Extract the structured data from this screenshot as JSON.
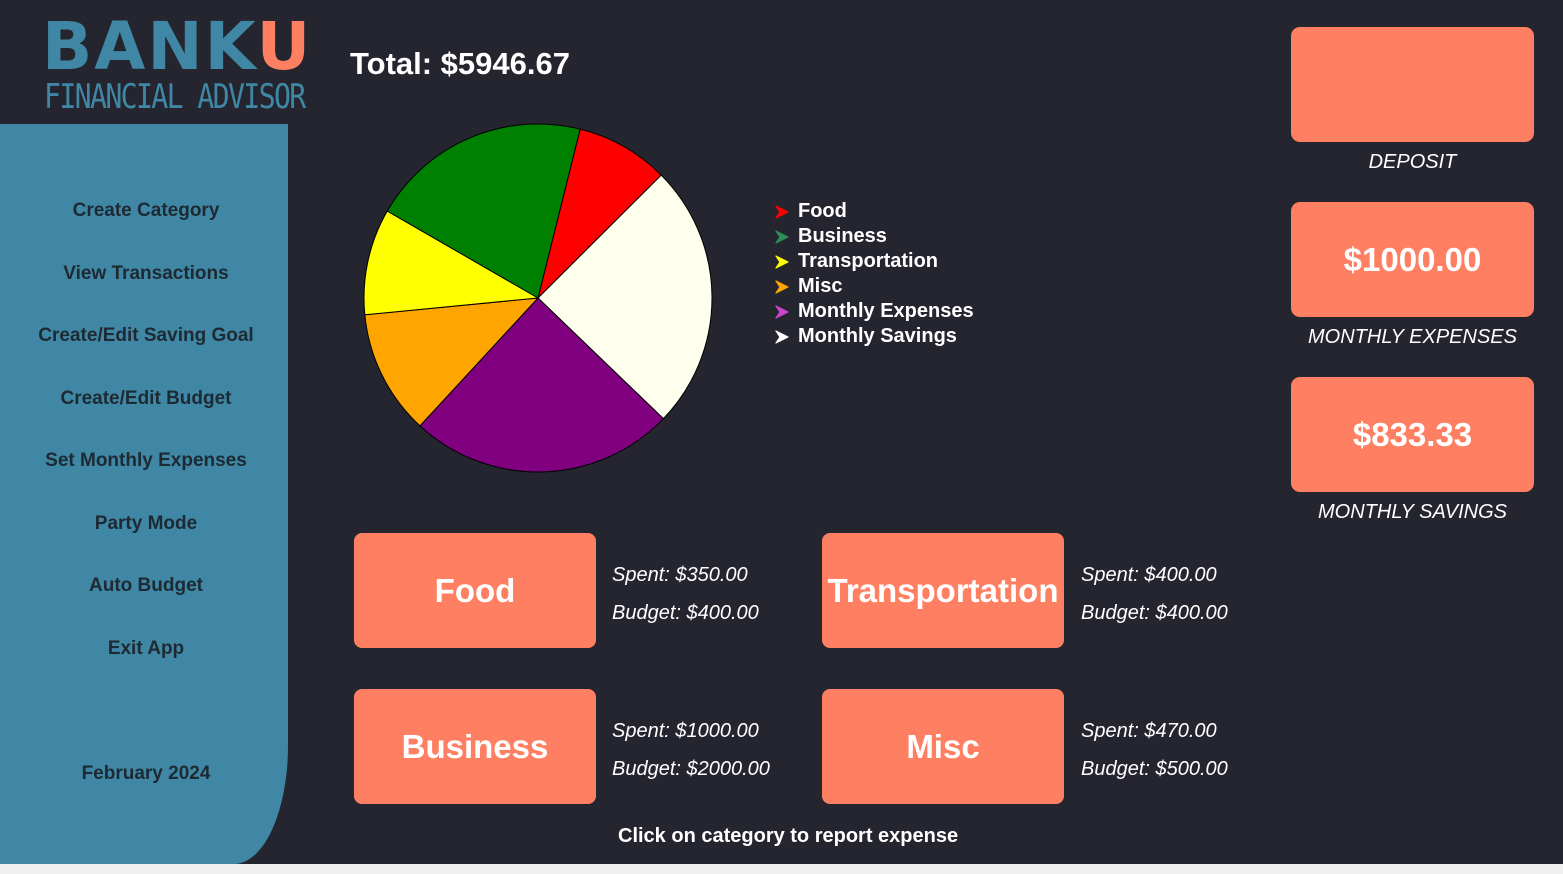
{
  "logo": {
    "main": "BANK",
    "accent": "U",
    "sub": "FINANCIAL ADVISOR"
  },
  "sidebar": {
    "items": [
      {
        "label": "Create Category"
      },
      {
        "label": "View Transactions"
      },
      {
        "label": "Create/Edit Saving Goal"
      },
      {
        "label": "Create/Edit Budget"
      },
      {
        "label": "Set Monthly Expenses"
      },
      {
        "label": "Party Mode"
      },
      {
        "label": "Auto Budget"
      },
      {
        "label": "Exit App"
      }
    ],
    "date": "February 2024"
  },
  "total_label": "Total: $5946.67",
  "chart_data": {
    "type": "pie",
    "slices": [
      {
        "label": "Food",
        "value": 350,
        "color": "#ff0000"
      },
      {
        "label": "Business",
        "value": 1000,
        "color": "#ffffee"
      },
      {
        "label": "Monthly Expenses",
        "value": 1000,
        "color": "#800080"
      },
      {
        "label": "Misc",
        "value": 470,
        "color": "#ffa500"
      },
      {
        "label": "Transportation",
        "value": 400,
        "color": "#ffff00"
      },
      {
        "label": "Monthly Savings",
        "value": 833.33,
        "color": "#008000"
      }
    ],
    "legend": [
      {
        "label": "Food",
        "color": "#ff0000"
      },
      {
        "label": "Business",
        "color": "#2e8b57"
      },
      {
        "label": "Transportation",
        "color": "#ffff00"
      },
      {
        "label": "Misc",
        "color": "#ffa500"
      },
      {
        "label": "Monthly Expenses",
        "color": "#cc44cc"
      },
      {
        "label": "Monthly Savings",
        "color": "#ffffff"
      }
    ],
    "legend_placement": "right",
    "start_angle_deg": -76,
    "direction": "clockwise"
  },
  "categories": [
    {
      "name": "Food",
      "spent": "Spent: $350.00",
      "budget": "Budget: $400.00"
    },
    {
      "name": "Transportation",
      "spent": "Spent: $400.00",
      "budget": "Budget: $400.00"
    },
    {
      "name": "Business",
      "spent": "Spent: $1000.00",
      "budget": "Budget: $2000.00"
    },
    {
      "name": "Misc",
      "spent": "Spent: $470.00",
      "budget": "Budget: $500.00"
    }
  ],
  "right_panel": {
    "deposit": {
      "value": "",
      "label": "DEPOSIT"
    },
    "monthly_expenses": {
      "value": "$1000.00",
      "label": "MONTHLY EXPENSES"
    },
    "monthly_savings": {
      "value": "$833.33",
      "label": "MONTHLY SAVINGS"
    }
  },
  "hint": "Click on category to report expense",
  "colors": {
    "background": "#252530",
    "sidebar": "#3f87a4",
    "accent": "#fe7f62",
    "text": "#ffffff"
  }
}
